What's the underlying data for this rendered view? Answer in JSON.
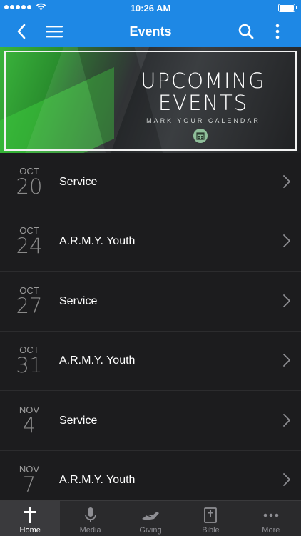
{
  "status_bar": {
    "time": "10:26 AM"
  },
  "nav": {
    "title": "Events"
  },
  "banner": {
    "line1": "UPCOMING",
    "line2": "EVENTS",
    "subtitle": "MARK YOUR CALENDAR"
  },
  "events": [
    {
      "month": "OCT",
      "day": "20",
      "title": "Service"
    },
    {
      "month": "OCT",
      "day": "24",
      "title": "A.R.M.Y. Youth"
    },
    {
      "month": "OCT",
      "day": "27",
      "title": "Service"
    },
    {
      "month": "OCT",
      "day": "31",
      "title": "A.R.M.Y. Youth"
    },
    {
      "month": "NOV",
      "day": "4",
      "title": "Service"
    },
    {
      "month": "NOV",
      "day": "7",
      "title": "A.R.M.Y. Youth"
    }
  ],
  "tabs": [
    {
      "label": "Home",
      "icon": "cross-icon",
      "active": true
    },
    {
      "label": "Media",
      "icon": "microphone-icon",
      "active": false
    },
    {
      "label": "Giving",
      "icon": "giving-hand-icon",
      "active": false
    },
    {
      "label": "Bible",
      "icon": "bible-icon",
      "active": false
    },
    {
      "label": "More",
      "icon": "more-dots-icon",
      "active": false
    }
  ],
  "colors": {
    "accent": "#1e88e5",
    "background": "#1c1c1e",
    "tab_bar": "#2a2a2c"
  }
}
